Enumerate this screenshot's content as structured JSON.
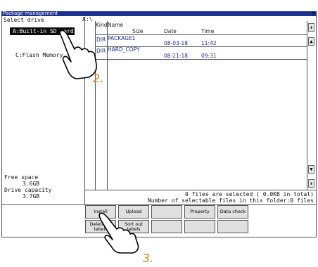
{
  "window": {
    "title": "Package management",
    "close_glyph": "×"
  },
  "drive_panel": {
    "heading": "Select drive",
    "drive_a": "A:Built-in SD card",
    "drive_c": "C:Flash Memory",
    "free_space_label": "Free space",
    "free_space_value": "3.6GB",
    "capacity_label": "Drive capacity",
    "capacity_value": "3.7GB"
  },
  "file_list": {
    "path": "A:\\",
    "columns": {
      "kind": "Kind",
      "name": "Name",
      "size": "Size",
      "date": "Date",
      "time": "Time"
    },
    "rows": [
      {
        "kind": "DIR",
        "name": "PACKAGE1",
        "date": "08-03-18",
        "time": "11:42"
      },
      {
        "kind": "DIR",
        "name": "HARD_COPY",
        "date": "08-21-18",
        "time": "09:31"
      }
    ],
    "status_line1": "0 files are selected (   0.0KB in total)",
    "status_line2": "Number of selectable files in this folder:0 files"
  },
  "buttons": {
    "install": "Install",
    "upload": "Upload",
    "property": "Property",
    "data_check": "Data check",
    "delete_all_labels": "Delete all labels",
    "sort_out_labels": "Sort out labels"
  },
  "scrollbar": {
    "up_glyph": "▲",
    "down_glyph": "▼",
    "top_glyph": "⇞",
    "bottom_glyph": "⇟"
  },
  "annotations": {
    "step2": "2.",
    "step3": "3."
  }
}
